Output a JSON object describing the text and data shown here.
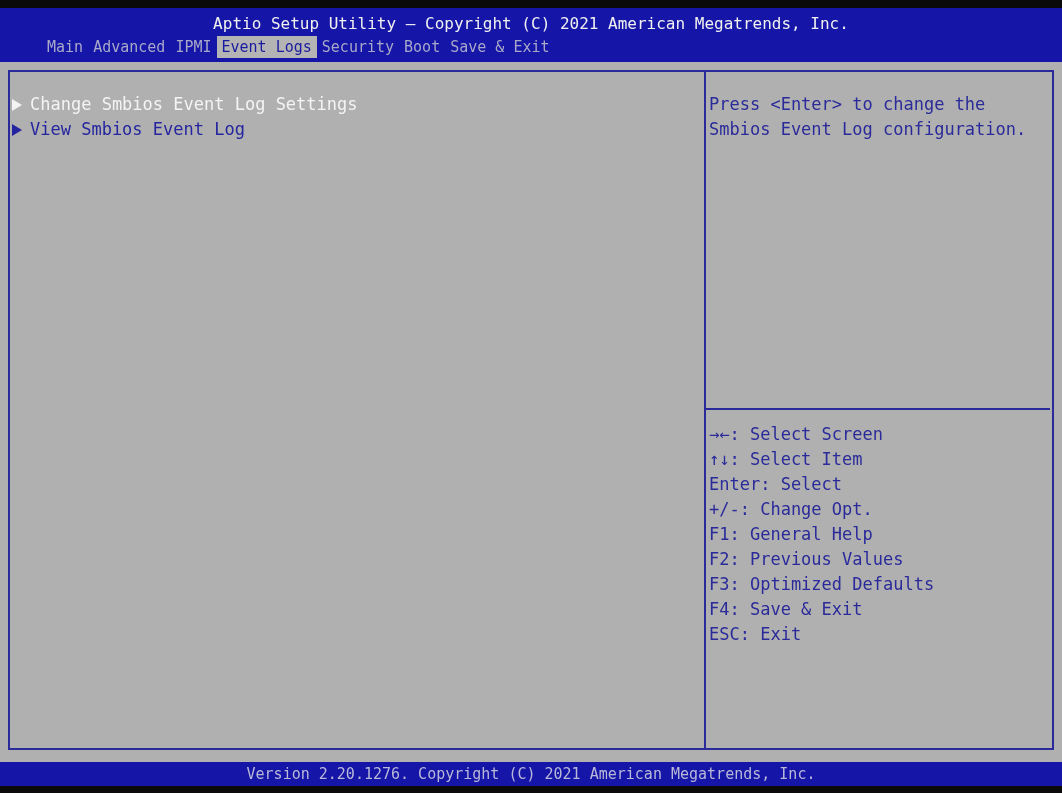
{
  "header": {
    "title": "Aptio Setup Utility – Copyright (C) 2021 American Megatrends, Inc."
  },
  "tabs": [
    {
      "label": "Main",
      "selected": false
    },
    {
      "label": "Advanced",
      "selected": false
    },
    {
      "label": "IPMI",
      "selected": false
    },
    {
      "label": "Event Logs",
      "selected": true
    },
    {
      "label": "Security",
      "selected": false
    },
    {
      "label": "Boot",
      "selected": false
    },
    {
      "label": "Save & Exit",
      "selected": false
    }
  ],
  "menu_items": [
    {
      "label": "Change Smbios Event Log Settings",
      "selected": true
    },
    {
      "label": "View Smbios Event Log",
      "selected": false
    }
  ],
  "help_text": "Press <Enter> to change the Smbios Event Log configuration.",
  "key_help": [
    "→←: Select Screen",
    "↑↓: Select Item",
    "Enter: Select",
    "+/-: Change Opt.",
    "F1: General Help",
    "F2: Previous Values",
    "F3: Optimized Defaults",
    "F4: Save & Exit",
    "ESC: Exit"
  ],
  "footer": "Version 2.20.1276. Copyright (C) 2021 American Megatrends, Inc."
}
